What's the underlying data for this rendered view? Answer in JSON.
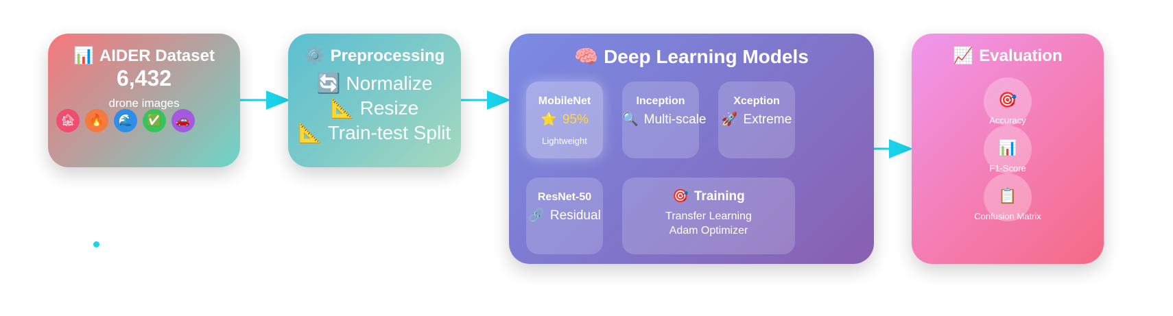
{
  "dataset": {
    "icon": "📊",
    "title": "AIDER Dataset",
    "count": "6,432",
    "subtitle": "drone images",
    "categories": [
      {
        "icon": "🏚",
        "color": "#ef4e6f"
      },
      {
        "icon": "🔥",
        "color": "#f47a3f"
      },
      {
        "icon": "🌊",
        "color": "#2f8fe8"
      },
      {
        "icon": "✅",
        "color": "#35c45a"
      },
      {
        "icon": "🚗",
        "color": "#a35adf"
      }
    ]
  },
  "preprocessing": {
    "icon": "⚙️",
    "title": "Preprocessing",
    "steps": [
      {
        "icon": "🔄",
        "label": "Normalize"
      },
      {
        "icon": "📐",
        "label": "Resize"
      },
      {
        "icon": "📐",
        "label": "Train-test Split"
      }
    ]
  },
  "models": {
    "icon": "🧠",
    "title": "Deep Learning Models",
    "mobilenet": {
      "name": "MobileNet",
      "icon": "⭐",
      "accuracy": "95%",
      "note": "Lightweight"
    },
    "inception": {
      "name": "Inception",
      "icon": "🔍",
      "detail": "Multi-scale"
    },
    "xception": {
      "name": "Xception",
      "icon": "🚀",
      "detail": "Extreme"
    },
    "resnet": {
      "name": "ResNet-50",
      "icon": "🔗",
      "detail": "Residual"
    },
    "training": {
      "icon": "🎯",
      "title": "Training",
      "line1": "Transfer Learning",
      "line2": "Adam Optimizer"
    }
  },
  "evaluation": {
    "icon": "📈",
    "title": "Evaluation",
    "metrics": [
      {
        "icon": "🎯",
        "label": "Accuracy"
      },
      {
        "icon": "📊",
        "label": "F1-Score"
      },
      {
        "icon": "📋",
        "label": "Confusion Matrix"
      }
    ]
  },
  "colors": {
    "arrow": "#1ad3ea",
    "accuracy_highlight": "#ffd54a"
  }
}
